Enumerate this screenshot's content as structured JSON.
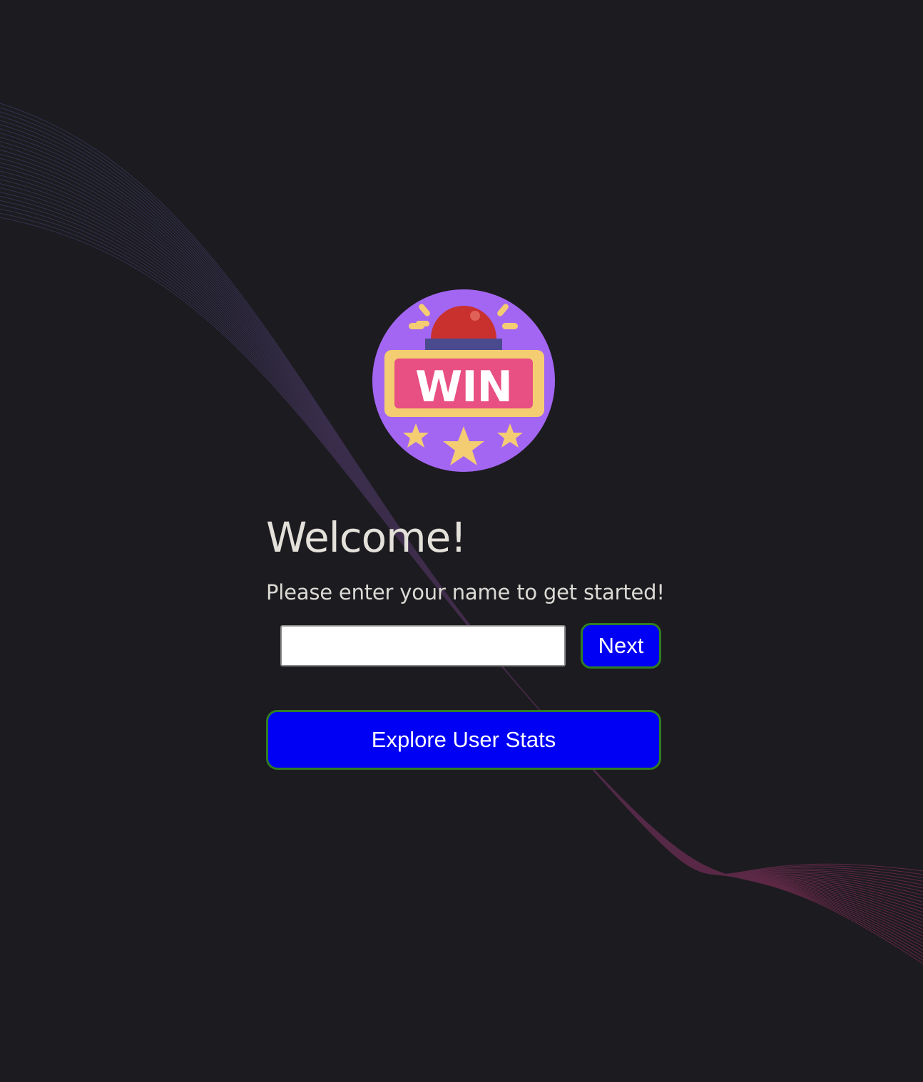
{
  "welcome": {
    "title": "Welcome!",
    "subtitle": "Please enter your name to get started!",
    "name_input": {
      "value": "",
      "placeholder": ""
    },
    "next_label": "Next",
    "explore_label": "Explore User Stats"
  },
  "logo": {
    "text": "WIN",
    "icon": "win-badge-icon"
  },
  "colors": {
    "background": "#1c1b20",
    "button_fill": "#0000f5",
    "button_border": "#2f7d23",
    "logo_circle": "#a366f2",
    "logo_banner": "#e84f82",
    "logo_frame": "#f4cd72",
    "wave_start": "#3b4a7a",
    "wave_end": "#b0305e"
  }
}
